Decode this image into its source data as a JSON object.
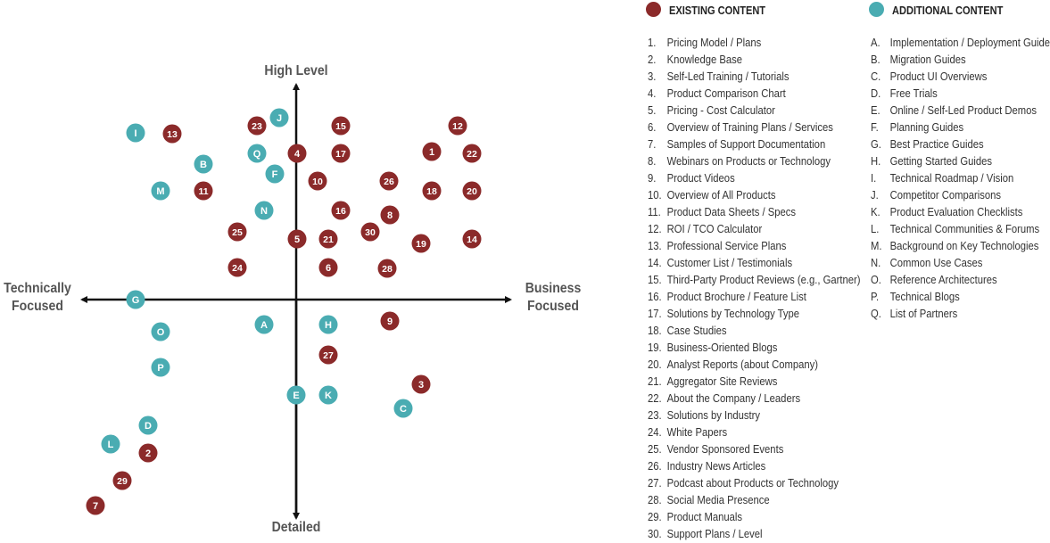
{
  "axes": {
    "top": "High Level",
    "bottom": "Detailed",
    "left": "Technically Focused",
    "right": "Business Focused"
  },
  "colors": {
    "existing": "#8b2a2a",
    "additional": "#4aacb2",
    "axis": "#111111"
  },
  "legend": {
    "existing_title": "EXISTING CONTENT",
    "additional_title": "ADDITIONAL CONTENT",
    "existing": [
      {
        "key": "1.",
        "label": "Pricing Model / Plans"
      },
      {
        "key": "2.",
        "label": "Knowledge Base"
      },
      {
        "key": "3.",
        "label": "Self-Led Training / Tutorials"
      },
      {
        "key": "4.",
        "label": "Product Comparison Chart"
      },
      {
        "key": "5.",
        "label": "Pricing - Cost Calculator"
      },
      {
        "key": "6.",
        "label": "Overview of Training Plans / Services"
      },
      {
        "key": "7.",
        "label": "Samples of Support Documentation"
      },
      {
        "key": "8.",
        "label": "Webinars on Products or Technology"
      },
      {
        "key": "9.",
        "label": "Product Videos"
      },
      {
        "key": "10.",
        "label": "Overview of All Products"
      },
      {
        "key": "11.",
        "label": "Product Data Sheets / Specs"
      },
      {
        "key": "12.",
        "label": "ROI / TCO Calculator"
      },
      {
        "key": "13.",
        "label": "Professional Service Plans"
      },
      {
        "key": "14.",
        "label": "Customer List / Testimonials"
      },
      {
        "key": "15.",
        "label": "Third-Party Product Reviews (e.g., Gartner)"
      },
      {
        "key": "16.",
        "label": "Product Brochure / Feature List"
      },
      {
        "key": "17.",
        "label": "Solutions by Technology Type"
      },
      {
        "key": "18.",
        "label": "Case Studies"
      },
      {
        "key": "19.",
        "label": "Business-Oriented Blogs"
      },
      {
        "key": "20.",
        "label": "Analyst Reports (about Company)"
      },
      {
        "key": "21.",
        "label": "Aggregator Site Reviews"
      },
      {
        "key": "22.",
        "label": "About the Company / Leaders"
      },
      {
        "key": "23.",
        "label": "Solutions by Industry"
      },
      {
        "key": "24.",
        "label": "White Papers"
      },
      {
        "key": "25.",
        "label": "Vendor Sponsored Events"
      },
      {
        "key": "26.",
        "label": "Industry News Articles"
      },
      {
        "key": "27.",
        "label": "Podcast about Products or Technology"
      },
      {
        "key": "28.",
        "label": "Social Media Presence"
      },
      {
        "key": "29.",
        "label": "Product Manuals"
      },
      {
        "key": "30.",
        "label": "Support Plans / Level"
      }
    ],
    "additional": [
      {
        "key": "A.",
        "label": "Implementation / Deployment Guides"
      },
      {
        "key": "B.",
        "label": "Migration Guides"
      },
      {
        "key": "C.",
        "label": "Product UI Overviews"
      },
      {
        "key": "D.",
        "label": "Free Trials"
      },
      {
        "key": "E.",
        "label": "Online / Self-Led Product Demos"
      },
      {
        "key": "F.",
        "label": "Planning Guides"
      },
      {
        "key": "G.",
        "label": "Best Practice Guides"
      },
      {
        "key": "H.",
        "label": "Getting Started Guides"
      },
      {
        "key": "I.",
        "label": "Technical Roadmap / Vision"
      },
      {
        "key": "J.",
        "label": "Competitor Comparisons"
      },
      {
        "key": "K.",
        "label": "Product Evaluation Checklists"
      },
      {
        "key": "L.",
        "label": "Technical Communities & Forums"
      },
      {
        "key": "M.",
        "label": "Background on Key Technologies"
      },
      {
        "key": "N.",
        "label": "Common Use Cases"
      },
      {
        "key": "O.",
        "label": "Reference Architectures"
      },
      {
        "key": "P.",
        "label": "Technical Blogs"
      },
      {
        "key": "Q.",
        "label": "List of Partners"
      }
    ]
  },
  "markers": {
    "existing": [
      "1",
      "2",
      "3",
      "4",
      "5",
      "6",
      "7",
      "8",
      "9",
      "10",
      "11",
      "12",
      "13",
      "14",
      "15",
      "16",
      "17",
      "18",
      "19",
      "20",
      "21",
      "22",
      "23",
      "24",
      "25",
      "26",
      "27",
      "28",
      "29",
      "30"
    ],
    "additional": [
      "A",
      "B",
      "C",
      "D",
      "E",
      "F",
      "G",
      "H",
      "I",
      "J",
      "K",
      "L",
      "M",
      "N",
      "O",
      "P",
      "Q"
    ]
  }
}
